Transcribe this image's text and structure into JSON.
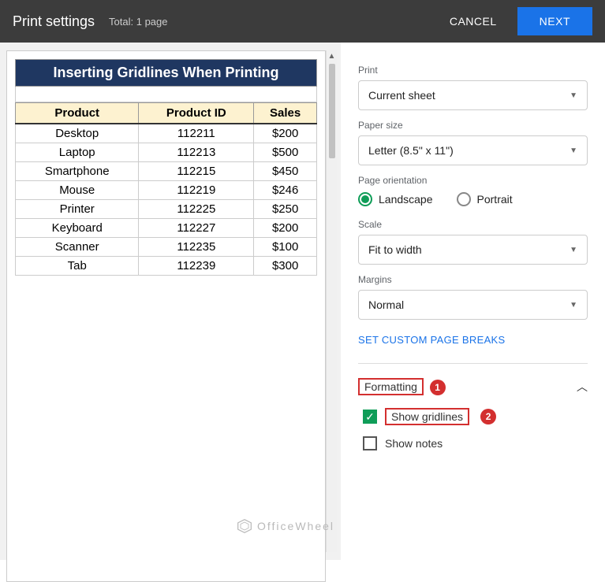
{
  "header": {
    "title": "Print settings",
    "total": "Total: 1 page",
    "cancel": "CANCEL",
    "next": "NEXT"
  },
  "sheet": {
    "title": "Inserting Gridlines When Printing",
    "columns": [
      "Product",
      "Product ID",
      "Sales"
    ],
    "rows": [
      [
        "Desktop",
        "112211",
        "$200"
      ],
      [
        "Laptop",
        "112213",
        "$500"
      ],
      [
        "Smartphone",
        "112215",
        "$450"
      ],
      [
        "Mouse",
        "112219",
        "$246"
      ],
      [
        "Printer",
        "112225",
        "$250"
      ],
      [
        "Keyboard",
        "112227",
        "$200"
      ],
      [
        "Scanner",
        "112235",
        "$100"
      ],
      [
        "Tab",
        "112239",
        "$300"
      ]
    ]
  },
  "panel": {
    "print_label": "Print",
    "print_value": "Current sheet",
    "paper_label": "Paper size",
    "paper_value": "Letter (8.5\" x 11\")",
    "orient_label": "Page orientation",
    "orient_landscape": "Landscape",
    "orient_portrait": "Portrait",
    "scale_label": "Scale",
    "scale_value": "Fit to width",
    "margins_label": "Margins",
    "margins_value": "Normal",
    "custom_breaks": "SET CUSTOM PAGE BREAKS",
    "formatting": "Formatting",
    "show_gridlines": "Show gridlines",
    "show_notes": "Show notes"
  },
  "annotations": {
    "b1": "1",
    "b2": "2"
  },
  "watermark": "OfficeWheel"
}
